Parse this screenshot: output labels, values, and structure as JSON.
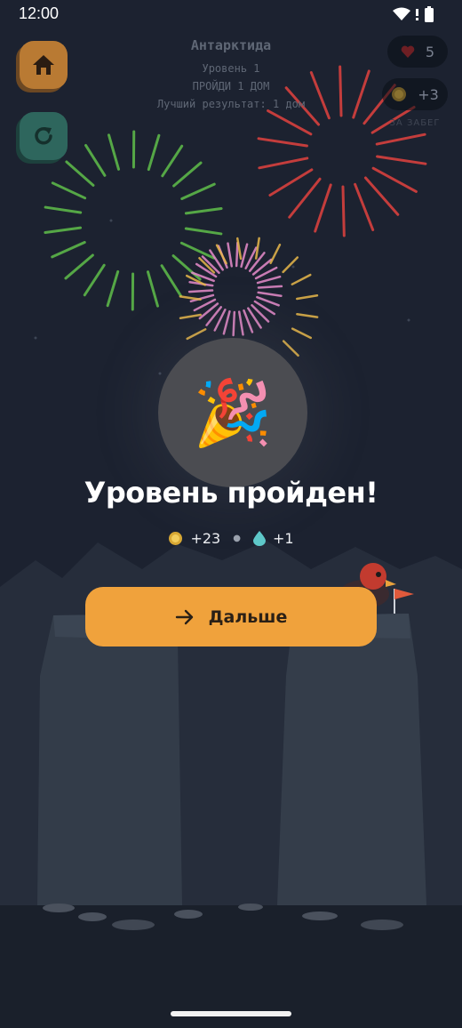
{
  "status_bar": {
    "time": "12:00"
  },
  "level_info": {
    "region": "Антарктида",
    "level": "Уровень 1",
    "goal": "ПРОЙДИ 1 ДОМ",
    "best": "Лучший результат: 1 дом"
  },
  "hud": {
    "lives": "5",
    "coins": "+3",
    "coins_caption": "ЗА ЗАБЕГ"
  },
  "result": {
    "title": "Уровень пройден!",
    "coins_reward": "+23",
    "drops_reward": "+1"
  },
  "next_button": {
    "label": "Дальше"
  },
  "colors": {
    "background": "#1c2230",
    "accent_orange": "#f0a23c",
    "home_button": "#b97a33",
    "restart_button": "#2e665d",
    "firework_green": "#5fbf4a",
    "firework_red": "#e2423f",
    "firework_pink": "#e88ccc",
    "firework_gold": "#e8b84a"
  },
  "icons": [
    "home-icon",
    "restart-icon",
    "heart-icon",
    "coin-icon",
    "drop-icon",
    "arrow-right-icon",
    "party-popper-icon",
    "wifi-icon",
    "signal-icon",
    "battery-icon"
  ]
}
